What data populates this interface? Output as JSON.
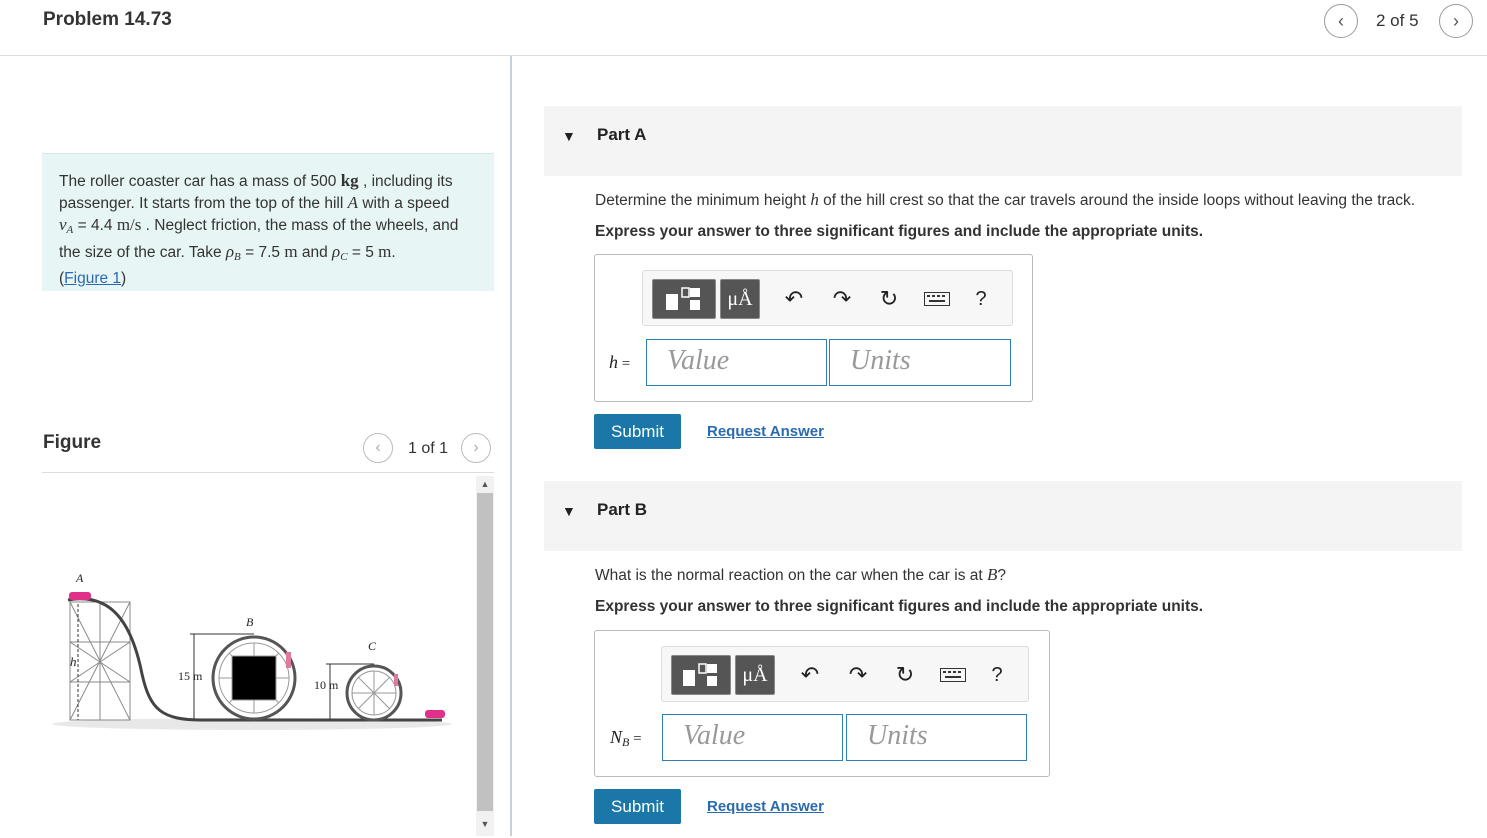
{
  "header": {
    "problem_title": "Problem 14.73",
    "page_counter": "2 of 5"
  },
  "problem": {
    "t1": "The roller coaster car has a mass of 500 ",
    "u_kg": "kg",
    "t2": " , including its passenger. It starts from the top of the hill ",
    "A": "A",
    "t3": " with a speed ",
    "v": "v",
    "v_sub": "A",
    "t4": " = 4.4 ",
    "u_ms": "m/s",
    "t5": " . Neglect friction, the mass of the wheels, and the size of the car. Take ",
    "rho": "ρ",
    "rhoB_sub": "B",
    "t6": " = 7.5 ",
    "u_m1": "m",
    "t7": " and ",
    "rhoC_sub": "C",
    "t8": " = 5 ",
    "u_m2": "m",
    "t9": ".",
    "figure_link": "Figure 1",
    "paren_open": "(",
    "paren_close": ")"
  },
  "figure": {
    "title": "Figure",
    "counter": "1 of 1",
    "labels": {
      "A": "A",
      "B": "B",
      "C": "C",
      "h": "h",
      "dim1": "15 m",
      "dim2": "10 m"
    }
  },
  "parts": [
    {
      "label": "Part A",
      "q_pre": "Determine the minimum height ",
      "q_var": "h",
      "q_post": " of the hill crest so that the car travels around the inside loops without leaving the track.",
      "instruction": "Express your answer to three significant figures and include the appropriate units.",
      "var_label": "h",
      "var_sub": "",
      "eq": " =",
      "value_placeholder": "Value",
      "units_placeholder": "Units",
      "submit": "Submit",
      "request": "Request Answer"
    },
    {
      "label": "Part B",
      "q_pre": "What is the normal reaction on the car when the car is at ",
      "q_var": "B",
      "q_post": "?",
      "instruction": "Express your answer to three significant figures and include the appropriate units.",
      "var_label": "N",
      "var_sub": "B",
      "eq": " =",
      "value_placeholder": "Value",
      "units_placeholder": "Units",
      "submit": "Submit",
      "request": "Request Answer"
    }
  ],
  "toolbar": {
    "mu_label": "μÅ",
    "help_label": "?"
  },
  "icons": [
    "chevron-left-icon",
    "chevron-right-icon",
    "caret-down-icon",
    "template-icon",
    "undo-icon",
    "redo-icon",
    "reset-icon",
    "keyboard-icon",
    "help-icon"
  ]
}
